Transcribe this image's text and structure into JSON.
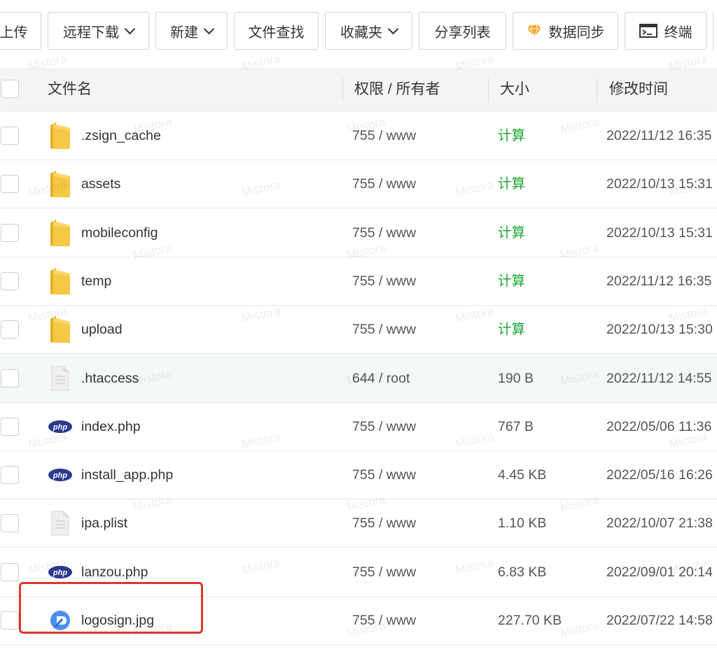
{
  "toolbar": {
    "upload": "上传",
    "remote_download": "远程下载",
    "new": "新建",
    "file_search": "文件查找",
    "favorites": "收藏夹",
    "share_list": "分享列表",
    "data_sync": "数据同步",
    "terminal": "终端"
  },
  "table": {
    "headers": {
      "name": "文件名",
      "permission": "权限 / 所有者",
      "size": "大小",
      "mtime": "修改时间"
    },
    "rows": [
      {
        "icon": "folder-icon",
        "name": ".zsign_cache",
        "perm": "755 / www",
        "size": "计算",
        "mtime": "2022/11/12 16:35"
      },
      {
        "icon": "folder-icon",
        "name": "assets",
        "perm": "755 / www",
        "size": "计算",
        "mtime": "2022/10/13 15:31"
      },
      {
        "icon": "folder-icon",
        "name": "mobileconfig",
        "perm": "755 / www",
        "size": "计算",
        "mtime": "2022/10/13 15:31"
      },
      {
        "icon": "folder-icon",
        "name": "temp",
        "perm": "755 / www",
        "size": "计算",
        "mtime": "2022/11/12 16:35"
      },
      {
        "icon": "folder-icon",
        "name": "upload",
        "perm": "755 / www",
        "size": "计算",
        "mtime": "2022/10/13 15:30"
      },
      {
        "icon": "document-icon",
        "name": ".htaccess",
        "perm": "644 / root",
        "size": "190 B",
        "mtime": "2022/11/12 14:55"
      },
      {
        "icon": "php-icon",
        "name": "index.php",
        "perm": "755 / www",
        "size": "767 B",
        "mtime": "2022/05/06 11:36"
      },
      {
        "icon": "php-icon",
        "name": "install_app.php",
        "perm": "755 / www",
        "size": "4.45 KB",
        "mtime": "2022/05/16 16:26"
      },
      {
        "icon": "document-icon",
        "name": "ipa.plist",
        "perm": "755 / www",
        "size": "1.10 KB",
        "mtime": "2022/10/07 21:38"
      },
      {
        "icon": "php-icon",
        "name": "lanzou.php",
        "perm": "755 / www",
        "size": "6.83 KB",
        "mtime": "2022/09/01 20:14"
      },
      {
        "icon": "image-icon",
        "name": "logosign.jpg",
        "perm": "755 / www",
        "size": "227.70 KB",
        "mtime": "2022/07/22 14:58"
      }
    ]
  },
  "watermark": "Mistora",
  "colors": {
    "calc_green": "#20a53a",
    "highlight_red": "#e0352b",
    "folder_yellow": "#f6c844",
    "php_blue": "#2b3a8f",
    "image_blue": "#4a8ef0"
  }
}
